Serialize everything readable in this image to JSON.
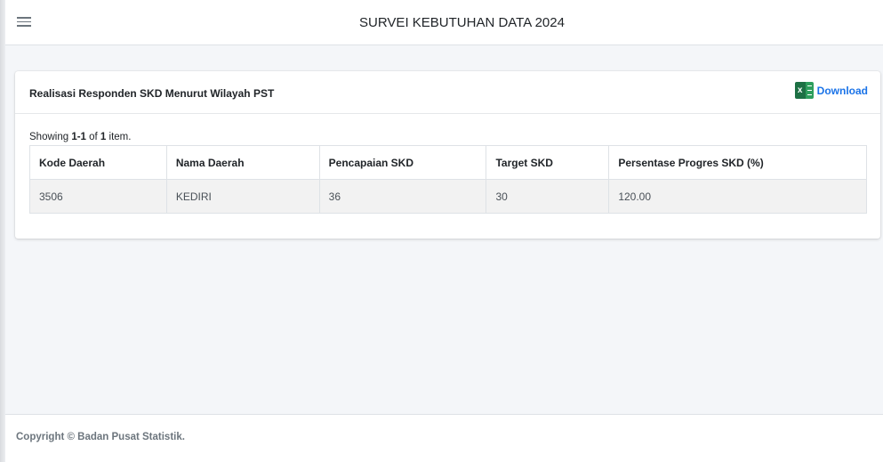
{
  "header": {
    "menu_icon": "hamburger-menu-icon",
    "title": "SURVEI KEBUTUHAN DATA 2024"
  },
  "card": {
    "title": "Realisasi Responden SKD Menurut Wilayah PST",
    "download_label": "Download",
    "download_icon": "excel-icon",
    "summary": {
      "prefix": "Showing ",
      "range": "1-1",
      "middle": " of ",
      "total": "1",
      "suffix": " item."
    },
    "table": {
      "columns": [
        "Kode Daerah",
        "Nama Daerah",
        "Pencapaian SKD",
        "Target SKD",
        "Persentase Progres SKD (%)"
      ],
      "rows": [
        [
          "3506",
          "KEDIRI",
          "36",
          "30",
          "120.00"
        ]
      ]
    }
  },
  "footer": {
    "copyright": "Copyright © Badan Pusat Statistik."
  },
  "colors": {
    "page_bg": "#f4f6f9",
    "link": "#1a73e8",
    "excel_green": "#1d7044",
    "row_bg": "#f2f2f2"
  }
}
